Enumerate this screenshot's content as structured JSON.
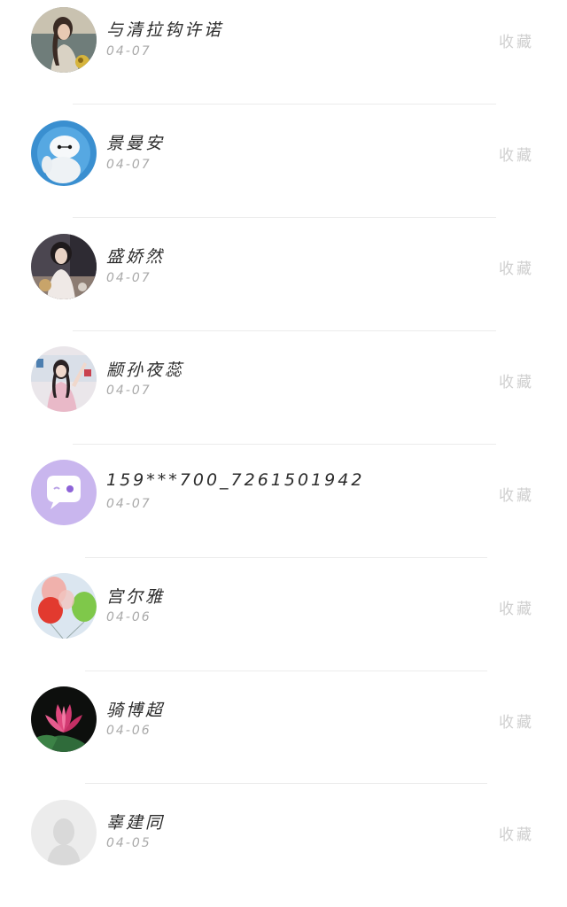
{
  "contacts": [
    {
      "name": "与清拉钩许诺",
      "date": "04-07",
      "action": "收藏",
      "avatar": "woman-photo-icon"
    },
    {
      "name": "景曼安",
      "date": "04-07",
      "action": "收藏",
      "avatar": "baymax-icon"
    },
    {
      "name": "盛娇然",
      "date": "04-07",
      "action": "收藏",
      "avatar": "girl-photo-icon"
    },
    {
      "name": "颛孙夜蕊",
      "date": "04-07",
      "action": "收藏",
      "avatar": "girl-pink-photo-icon"
    },
    {
      "name": "159***700_7261501942",
      "date": "04-07",
      "action": "收藏",
      "avatar": "chat-bubble-icon"
    },
    {
      "name": "宫尔雅",
      "date": "04-06",
      "action": "收藏",
      "avatar": "balloons-icon"
    },
    {
      "name": "骑博超",
      "date": "04-06",
      "action": "收藏",
      "avatar": "lotus-icon"
    },
    {
      "name": "辜建同",
      "date": "04-05",
      "action": "收藏",
      "avatar": "default-avatar-icon"
    }
  ]
}
